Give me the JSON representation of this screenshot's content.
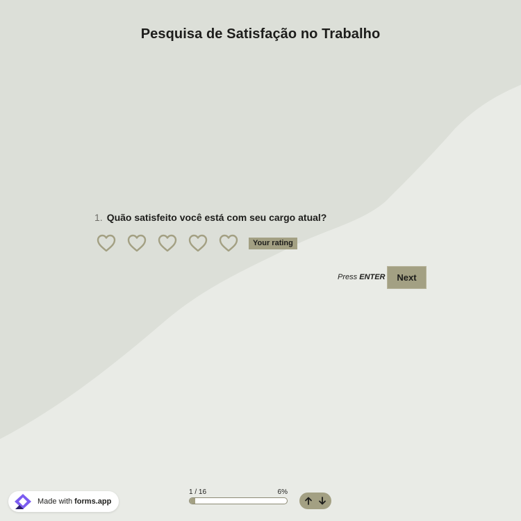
{
  "form": {
    "title": "Pesquisa de Satisfação no Trabalho"
  },
  "question": {
    "number": "1.",
    "text": "Quão satisfeito você está com seu cargo atual?",
    "rating_badge": "Your rating",
    "rating_icon": "heart-outline-icon",
    "rating_count": 5
  },
  "actions": {
    "press_prefix": "Press",
    "press_key": "ENTER",
    "next_label": "Next"
  },
  "footer": {
    "made_with_prefix": "Made with",
    "made_with_brand": "forms.app",
    "progress_label": "1 / 16",
    "progress_percent_label": "6%",
    "progress_fraction": 0.06
  },
  "colors": {
    "accent": "#a3a083",
    "background_light": "#e9ebe6",
    "background_dark": "#dcdfd8",
    "text": "#1d1d1b"
  }
}
